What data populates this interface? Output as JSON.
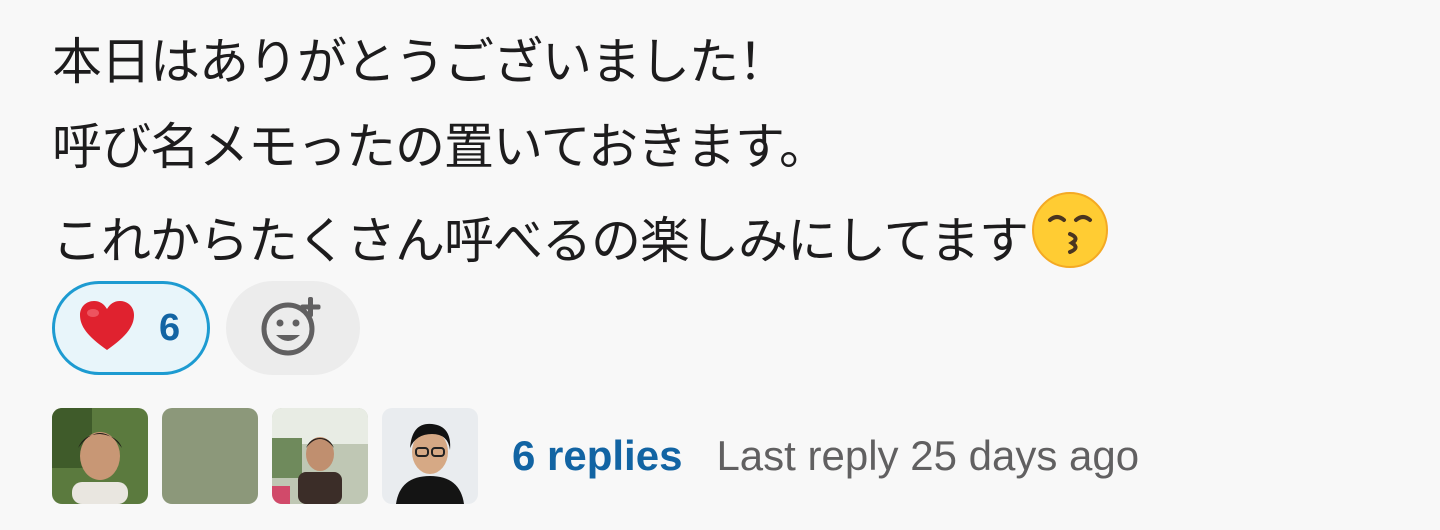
{
  "message": {
    "lines": [
      "本日はありがとうございました！",
      "呼び名メモったの置いておきます。",
      "これからたくさん呼べるの楽しみにしてます"
    ],
    "trailing_emoji": "kissing-face-emoji"
  },
  "reactions": [
    {
      "emoji": "heart-emoji",
      "count": "6",
      "selected": true
    }
  ],
  "add_reaction_icon": "add-reaction-icon",
  "thread": {
    "avatars": [
      "avatar-1",
      "avatar-2",
      "avatar-3",
      "avatar-4"
    ],
    "replies_label": "6 replies",
    "last_reply": "Last reply 25 days ago"
  },
  "colors": {
    "link": "#1264a3",
    "reaction_border": "#1d9bd1",
    "reaction_bg": "#e8f5fa",
    "muted_text": "#616061"
  }
}
